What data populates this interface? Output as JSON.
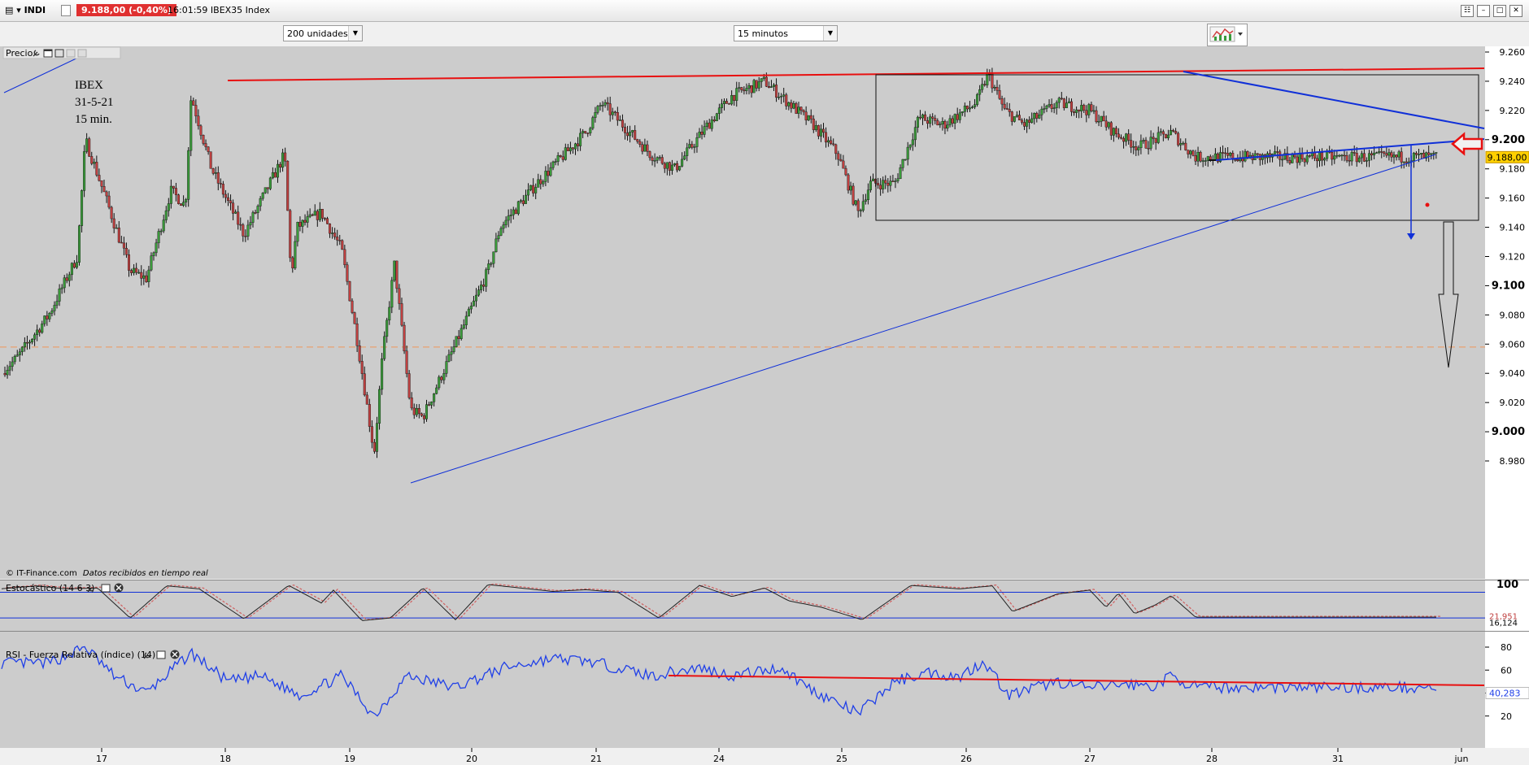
{
  "window": {
    "symbol": "INDI",
    "quote": "9.188,00 (-0,40%)",
    "time": "16:01:59",
    "instrument": "IBEX35 Index"
  },
  "toolbar": {
    "units_select": "200 unidades",
    "interval_select": "15 minutos"
  },
  "panels": {
    "price_label": "Precio",
    "stoch_label": "Estocástico (14 6 3)",
    "rsi_label": "RSI - Fuerza Relativa (índice) (14)"
  },
  "annotation": {
    "line1": "IBEX",
    "line2": "31-5-21",
    "line3": "15 min."
  },
  "footer": {
    "source": "© IT-Finance.com",
    "note": "Datos recibidos en tiempo real"
  },
  "colors": {
    "chart_bg": "#cccccc",
    "up_candle": "#3a9a3a",
    "down_candle": "#c04040",
    "trend_red": "#e81010",
    "trend_blue": "#1030d8",
    "rsi_line": "#2040e8",
    "stoch_k": "#222222",
    "stoch_d": "#d06060",
    "level_dashed": "#e8a070"
  },
  "chart_data": [
    {
      "type": "candlestick",
      "title": "IBEX 31-5-21 15 min.",
      "ylim": [
        8965,
        9270
      ],
      "y_ticks": [
        "9.260",
        "9.240",
        "9.220",
        "9.200",
        "9.180",
        "9.160",
        "9.140",
        "9.120",
        "9.100",
        "9.080",
        "9.060",
        "9.040",
        "9.020",
        "9.000",
        "8.980"
      ],
      "x_ticks": [
        "17",
        "18",
        "19",
        "20",
        "21",
        "24",
        "25",
        "26",
        "27",
        "28",
        "31",
        "jun"
      ],
      "last_price_label": "9.188,00",
      "reference_level": 9058,
      "anchors_x_price": [
        [
          0,
          9040
        ],
        [
          20,
          9050
        ],
        [
          60,
          9080
        ],
        [
          95,
          9120
        ],
        [
          105,
          9200
        ],
        [
          130,
          9160
        ],
        [
          160,
          9110
        ],
        [
          180,
          9105
        ],
        [
          210,
          9165
        ],
        [
          228,
          9155
        ],
        [
          235,
          9230
        ],
        [
          260,
          9180
        ],
        [
          300,
          9135
        ],
        [
          350,
          9190
        ],
        [
          358,
          9105
        ],
        [
          365,
          9140
        ],
        [
          395,
          9150
        ],
        [
          420,
          9125
        ],
        [
          440,
          9060
        ],
        [
          460,
          8985
        ],
        [
          470,
          9050
        ],
        [
          485,
          9115
        ],
        [
          505,
          9015
        ],
        [
          520,
          9010
        ],
        [
          560,
          9060
        ],
        [
          600,
          9110
        ],
        [
          615,
          9140
        ],
        [
          660,
          9170
        ],
        [
          720,
          9205
        ],
        [
          740,
          9225
        ],
        [
          800,
          9190
        ],
        [
          830,
          9180
        ],
        [
          870,
          9210
        ],
        [
          900,
          9230
        ],
        [
          940,
          9240
        ],
        [
          980,
          9220
        ],
        [
          1000,
          9210
        ],
        [
          1030,
          9190
        ],
        [
          1055,
          9150
        ],
        [
          1070,
          9170
        ],
        [
          1100,
          9170
        ],
        [
          1130,
          9215
        ],
        [
          1160,
          9210
        ],
        [
          1200,
          9225
        ],
        [
          1215,
          9245
        ],
        [
          1235,
          9220
        ],
        [
          1260,
          9210
        ],
        [
          1300,
          9225
        ],
        [
          1340,
          9220
        ],
        [
          1370,
          9205
        ],
        [
          1400,
          9195
        ],
        [
          1440,
          9205
        ],
        [
          1470,
          9188
        ]
      ]
    },
    {
      "type": "line",
      "title": "Estocástico (14 6 3)",
      "ylim": [
        0,
        110
      ],
      "y_ticks": [
        "100"
      ],
      "levels": [
        80,
        20
      ],
      "last_values": [
        "21,951",
        "16,124"
      ],
      "anchors_x_value": [
        [
          0,
          88
        ],
        [
          45,
          95
        ],
        [
          80,
          88
        ],
        [
          120,
          90
        ],
        [
          160,
          20
        ],
        [
          205,
          95
        ],
        [
          245,
          88
        ],
        [
          300,
          18
        ],
        [
          355,
          96
        ],
        [
          395,
          55
        ],
        [
          410,
          85
        ],
        [
          445,
          14
        ],
        [
          480,
          20
        ],
        [
          520,
          90
        ],
        [
          560,
          16
        ],
        [
          600,
          98
        ],
        [
          640,
          90
        ],
        [
          680,
          82
        ],
        [
          720,
          86
        ],
        [
          760,
          80
        ],
        [
          810,
          20
        ],
        [
          860,
          96
        ],
        [
          900,
          70
        ],
        [
          940,
          90
        ],
        [
          970,
          60
        ],
        [
          1010,
          45
        ],
        [
          1060,
          16
        ],
        [
          1120,
          96
        ],
        [
          1180,
          88
        ],
        [
          1220,
          95
        ],
        [
          1245,
          35
        ],
        [
          1300,
          76
        ],
        [
          1340,
          85
        ],
        [
          1360,
          45
        ],
        [
          1375,
          78
        ],
        [
          1395,
          30
        ],
        [
          1420,
          50
        ],
        [
          1440,
          72
        ],
        [
          1470,
          22
        ]
      ]
    },
    {
      "type": "line",
      "title": "RSI - Fuerza Relativa (índice) (14)",
      "ylim": [
        0,
        100
      ],
      "y_ticks": [
        "80",
        "60",
        "40",
        "20"
      ],
      "last_value_label": "40,283",
      "anchors_x_value": [
        [
          0,
          66
        ],
        [
          60,
          66
        ],
        [
          105,
          80
        ],
        [
          140,
          55
        ],
        [
          180,
          40
        ],
        [
          235,
          75
        ],
        [
          280,
          50
        ],
        [
          320,
          55
        ],
        [
          370,
          38
        ],
        [
          420,
          55
        ],
        [
          460,
          20
        ],
        [
          500,
          55
        ],
        [
          560,
          45
        ],
        [
          620,
          62
        ],
        [
          680,
          70
        ],
        [
          720,
          68
        ],
        [
          760,
          62
        ],
        [
          800,
          55
        ],
        [
          860,
          62
        ],
        [
          900,
          55
        ],
        [
          960,
          62
        ],
        [
          1000,
          42
        ],
        [
          1055,
          22
        ],
        [
          1100,
          50
        ],
        [
          1140,
          58
        ],
        [
          1180,
          54
        ],
        [
          1210,
          68
        ],
        [
          1240,
          38
        ],
        [
          1300,
          50
        ],
        [
          1340,
          44
        ],
        [
          1380,
          48
        ],
        [
          1420,
          46
        ],
        [
          1440,
          55
        ],
        [
          1470,
          45
        ]
      ]
    }
  ]
}
